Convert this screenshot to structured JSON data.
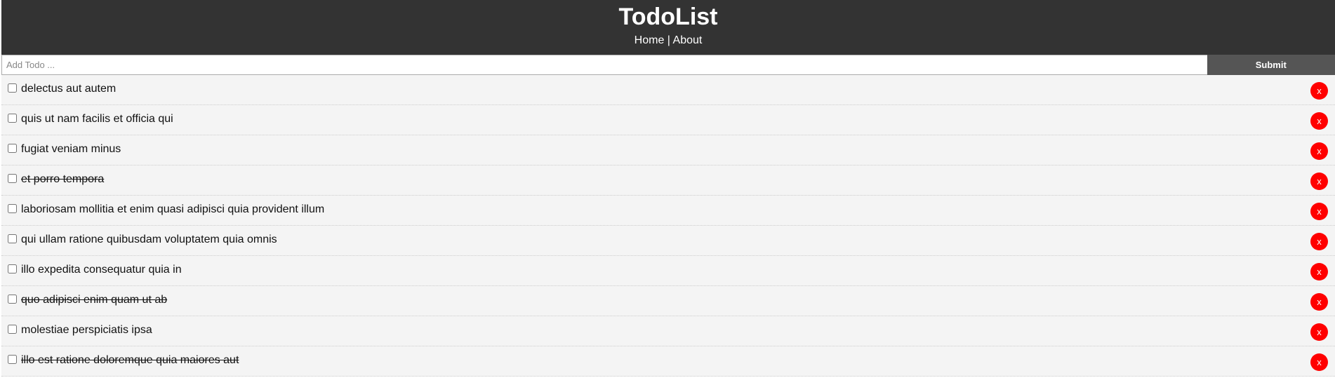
{
  "header": {
    "title": "TodoList",
    "nav": {
      "home": "Home",
      "separator": " | ",
      "about": "About"
    }
  },
  "form": {
    "placeholder": "Add Todo ...",
    "value": "",
    "submit_label": "Submit"
  },
  "delete_label": "x",
  "colors": {
    "header_bg": "#333333",
    "submit_bg": "#555555",
    "delete_bg": "#ff0000",
    "row_bg": "#f4f4f4"
  },
  "todos": [
    {
      "title": "delectus aut autem",
      "completed": false
    },
    {
      "title": "quis ut nam facilis et officia qui",
      "completed": false
    },
    {
      "title": "fugiat veniam minus",
      "completed": false
    },
    {
      "title": "et porro tempora",
      "completed": true
    },
    {
      "title": "laboriosam mollitia et enim quasi adipisci quia provident illum",
      "completed": false
    },
    {
      "title": "qui ullam ratione quibusdam voluptatem quia omnis",
      "completed": false
    },
    {
      "title": "illo expedita consequatur quia in",
      "completed": false
    },
    {
      "title": "quo adipisci enim quam ut ab",
      "completed": true
    },
    {
      "title": "molestiae perspiciatis ipsa",
      "completed": false
    },
    {
      "title": "illo est ratione doloremque quia maiores aut",
      "completed": true
    }
  ]
}
